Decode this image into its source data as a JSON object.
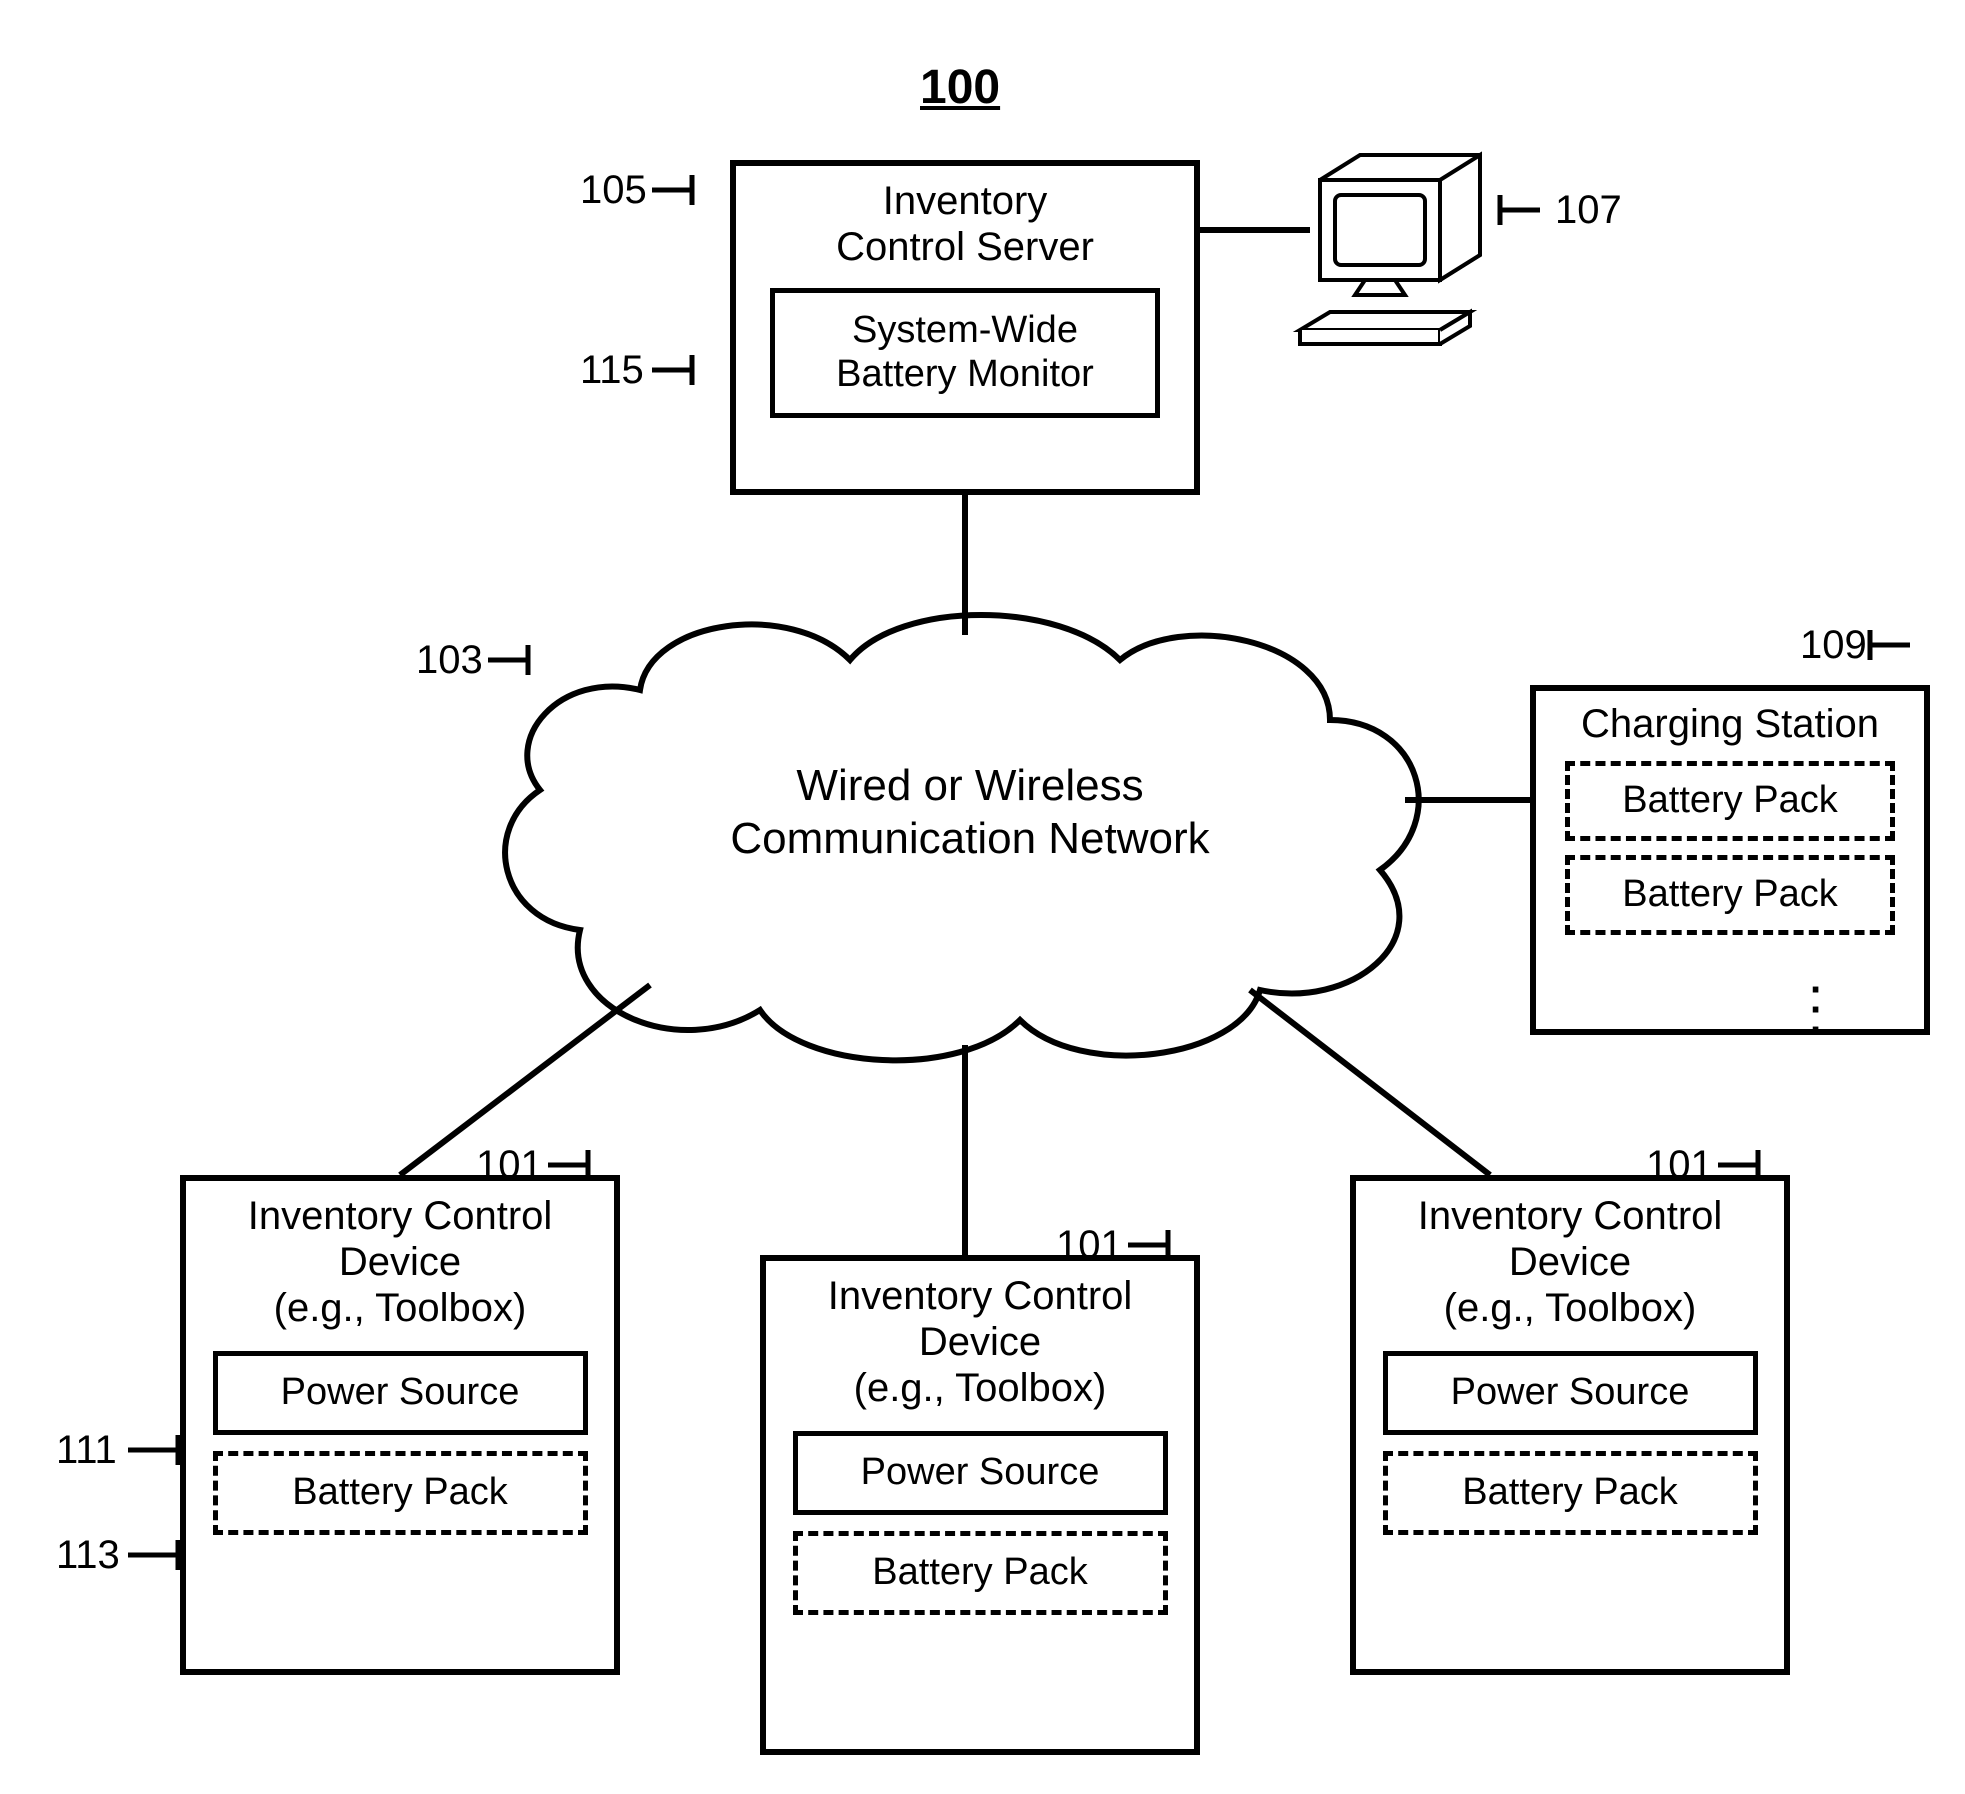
{
  "figure_number": "100",
  "refs": {
    "r105": "105",
    "r107": "107",
    "r115": "115",
    "r103": "103",
    "r109": "109",
    "r101a": "101",
    "r101b": "101",
    "r101c": "101",
    "r111": "111",
    "r113": "113"
  },
  "server": {
    "title": "Inventory\nControl Server",
    "monitor": "System-Wide\nBattery Monitor"
  },
  "cloud_text": "Wired or Wireless\nCommunication Network",
  "charging": {
    "title": "Charging Station",
    "pack1": "Battery Pack",
    "pack2": "Battery Pack"
  },
  "device": {
    "title": "Inventory Control\nDevice\n(e.g., Toolbox)",
    "power": "Power Source",
    "battery": "Battery Pack"
  }
}
